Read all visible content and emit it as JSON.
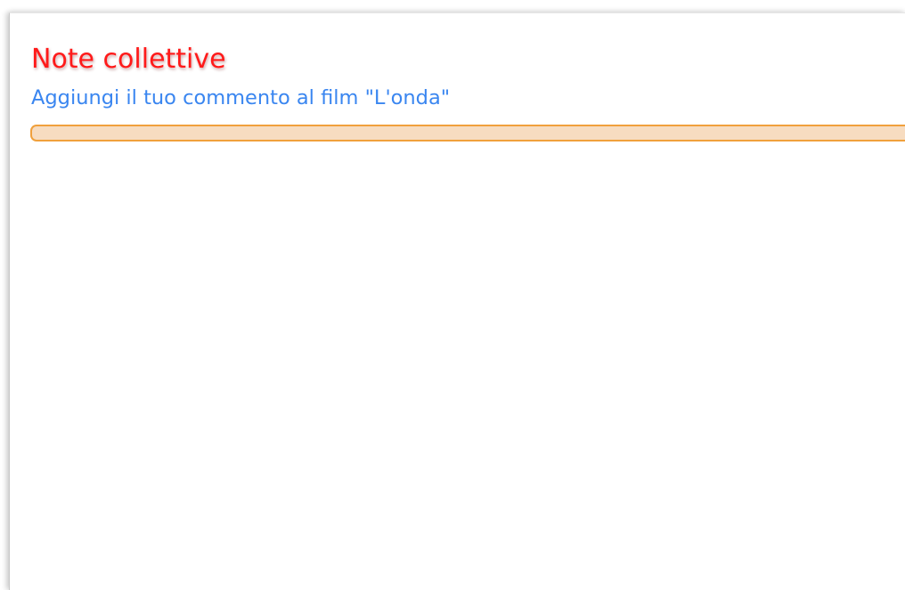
{
  "section": {
    "title": "Note collettive",
    "link_text": "Aggiungi il tuo commento al film \"L'onda\"",
    "progress_value": 1.0
  },
  "colors": {
    "title": "#ff1a1a",
    "link": "#3a86f0",
    "progress_border": "#f0a03c",
    "progress_fill": "#f7dcc0"
  }
}
